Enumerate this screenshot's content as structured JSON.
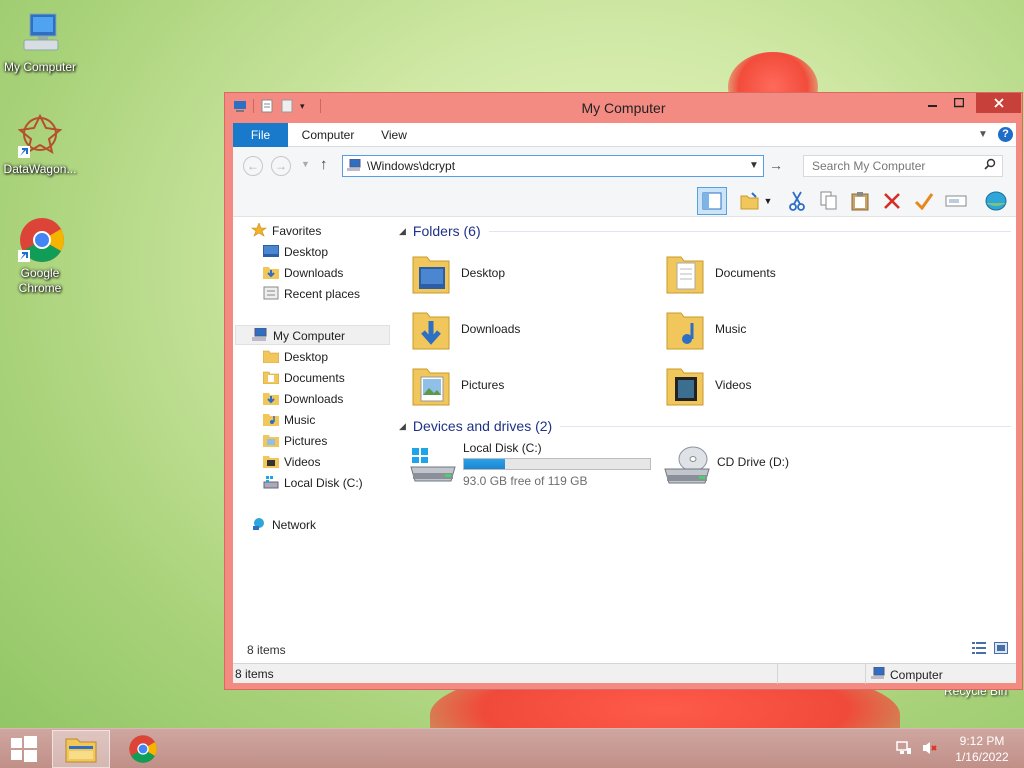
{
  "desktop": {
    "icons": [
      {
        "label": "My Computer"
      },
      {
        "label": "DataWagon..."
      },
      {
        "label": "Google Chrome"
      }
    ],
    "recycle_bin_label": "Recycle Bin"
  },
  "window": {
    "title": "My Computer",
    "ribbon": {
      "tabs": [
        "File",
        "Computer",
        "View"
      ],
      "help": "?"
    },
    "address": {
      "path": "\\Windows\\dcrypt",
      "search_placeholder": "Search My Computer"
    },
    "nav_pane": {
      "favorites_label": "Favorites",
      "favorites": [
        "Desktop",
        "Downloads",
        "Recent places"
      ],
      "computer_label": "My Computer",
      "computer_items": [
        "Desktop",
        "Documents",
        "Downloads",
        "Music",
        "Pictures",
        "Videos",
        "Local Disk (C:)"
      ],
      "network_label": "Network"
    },
    "content": {
      "folders_header": "Folders (6)",
      "folders": [
        "Desktop",
        "Documents",
        "Downloads",
        "Music",
        "Pictures",
        "Videos"
      ],
      "devices_header": "Devices and drives (2)",
      "drives": [
        {
          "name": "Local Disk (C:)",
          "free_text": "93.0 GB free of 119 GB",
          "used_fraction": 0.22
        },
        {
          "name": "CD Drive (D:)"
        }
      ]
    },
    "status_inner": "8 items",
    "status_outer": {
      "items": "8 items",
      "location": "Computer"
    }
  },
  "taskbar": {
    "time": "9:12 PM",
    "date": "1/16/2022"
  },
  "colors": {
    "accent": "#1979ca",
    "window_frame": "#f48b82",
    "close_button": "#c7413a",
    "drive_bar": "#26a0da"
  }
}
